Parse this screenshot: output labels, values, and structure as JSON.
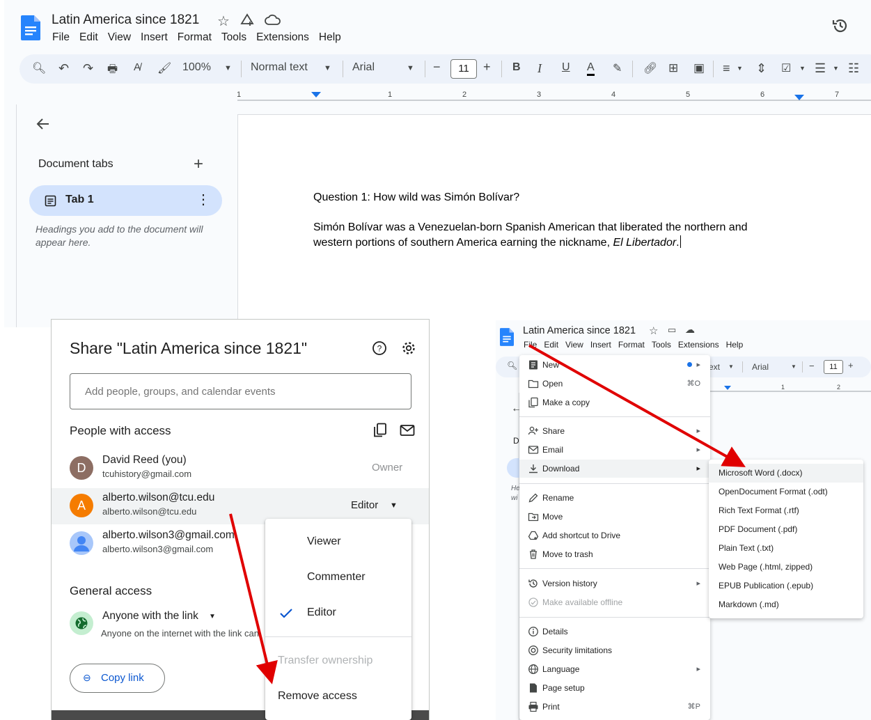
{
  "main": {
    "doc_title": "Latin America since 1821",
    "menu": [
      "File",
      "Edit",
      "View",
      "Insert",
      "Format",
      "Tools",
      "Extensions",
      "Help"
    ],
    "toolbar": {
      "zoom": "100%",
      "style": "Normal text",
      "font": "Arial",
      "font_size": "11",
      "minus": "−",
      "plus": "+",
      "bold": "B",
      "italic": "I",
      "underline": "U",
      "text_color": "A"
    },
    "ruler_numbers": [
      "1",
      "1",
      "2",
      "3",
      "4",
      "5",
      "6",
      "7"
    ],
    "sidebar": {
      "heading": "Document tabs",
      "tab_label": "Tab 1",
      "hint": "Headings you add to the document will appear here."
    },
    "doc": {
      "question": "Question 1: How wild was Simón Bolívar?",
      "line1": "Simón Bolívar was a Venezuelan-born Spanish American that liberated the northern and",
      "line2_prefix": "western portions of southern America earning the nickname, ",
      "line2_italic": "El Libertador",
      "line2_suffix": "."
    }
  },
  "share": {
    "title": "Share \"Latin America since 1821\"",
    "input_placeholder": "Add people, groups, and calendar events",
    "people_heading": "People with access",
    "people": [
      {
        "initial": "D",
        "name": "David Reed (you)",
        "email": "tcuhistory@gmail.com",
        "role": "Owner",
        "color": "#8d6e63"
      },
      {
        "initial": "A",
        "name": "alberto.wilson@tcu.edu",
        "email": "alberto.wilson@tcu.edu",
        "role": "Editor",
        "color": "#f57c00"
      },
      {
        "initial": "",
        "name": "alberto.wilson3@gmail.com",
        "email": "alberto.wilson3@gmail.com",
        "role": "",
        "color": "#a8c7fa"
      }
    ],
    "general_heading": "General access",
    "general_link": "Anyone with the link",
    "general_desc": "Anyone on the internet with the link can",
    "copy_link": "Copy link",
    "role_menu": {
      "viewer": "Viewer",
      "commenter": "Commenter",
      "editor": "Editor",
      "transfer": "Transfer ownership",
      "remove": "Remove access"
    }
  },
  "file_screen": {
    "doc_title": "Latin America since 1821",
    "menu": [
      "File",
      "Edit",
      "View",
      "Insert",
      "Format",
      "Tools",
      "Extensions",
      "Help"
    ],
    "toolbar_partial": {
      "text": "ext",
      "font": "Arial",
      "font_size": "11"
    },
    "sidebar_letters": {
      "d": "D",
      "hint_a": "He",
      "hint_b": "wi"
    },
    "file_menu": [
      {
        "label": "New",
        "icon": "new-doc-icon",
        "right": "▸"
      },
      {
        "label": "Open",
        "icon": "folder-icon",
        "right": "⌘O"
      },
      {
        "label": "Make a copy",
        "icon": "copy-icon",
        "right": ""
      },
      {
        "label": "Share",
        "icon": "person-add-icon",
        "right": "▸"
      },
      {
        "label": "Email",
        "icon": "email-icon",
        "right": "▸"
      },
      {
        "label": "Download",
        "icon": "download-icon",
        "right": "▸"
      },
      {
        "label": "Rename",
        "icon": "pencil-icon",
        "right": ""
      },
      {
        "label": "Move",
        "icon": "move-folder-icon",
        "right": ""
      },
      {
        "label": "Add shortcut to Drive",
        "icon": "drive-shortcut-icon",
        "right": ""
      },
      {
        "label": "Move to trash",
        "icon": "trash-icon",
        "right": ""
      },
      {
        "label": "Version history",
        "icon": "history-icon",
        "right": "▸"
      },
      {
        "label": "Make available offline",
        "icon": "offline-icon",
        "right": ""
      },
      {
        "label": "Details",
        "icon": "info-icon",
        "right": ""
      },
      {
        "label": "Security limitations",
        "icon": "security-icon",
        "right": ""
      },
      {
        "label": "Language",
        "icon": "globe-icon",
        "right": "▸"
      },
      {
        "label": "Page setup",
        "icon": "page-setup-icon",
        "right": ""
      },
      {
        "label": "Print",
        "icon": "print-icon",
        "right": "⌘P"
      }
    ],
    "download_menu": [
      "Microsoft Word (.docx)",
      "OpenDocument Format (.odt)",
      "Rich Text Format (.rtf)",
      "PDF Document (.pdf)",
      "Plain Text (.txt)",
      "Web Page (.html, zipped)",
      "EPUB Publication (.epub)",
      "Markdown (.md)"
    ]
  },
  "colors": {
    "accent_blue": "#0b57d0",
    "tab_highlight": "#d3e3fd",
    "toolbar_bg": "#edf2fa",
    "arrow_red": "#e00000"
  }
}
